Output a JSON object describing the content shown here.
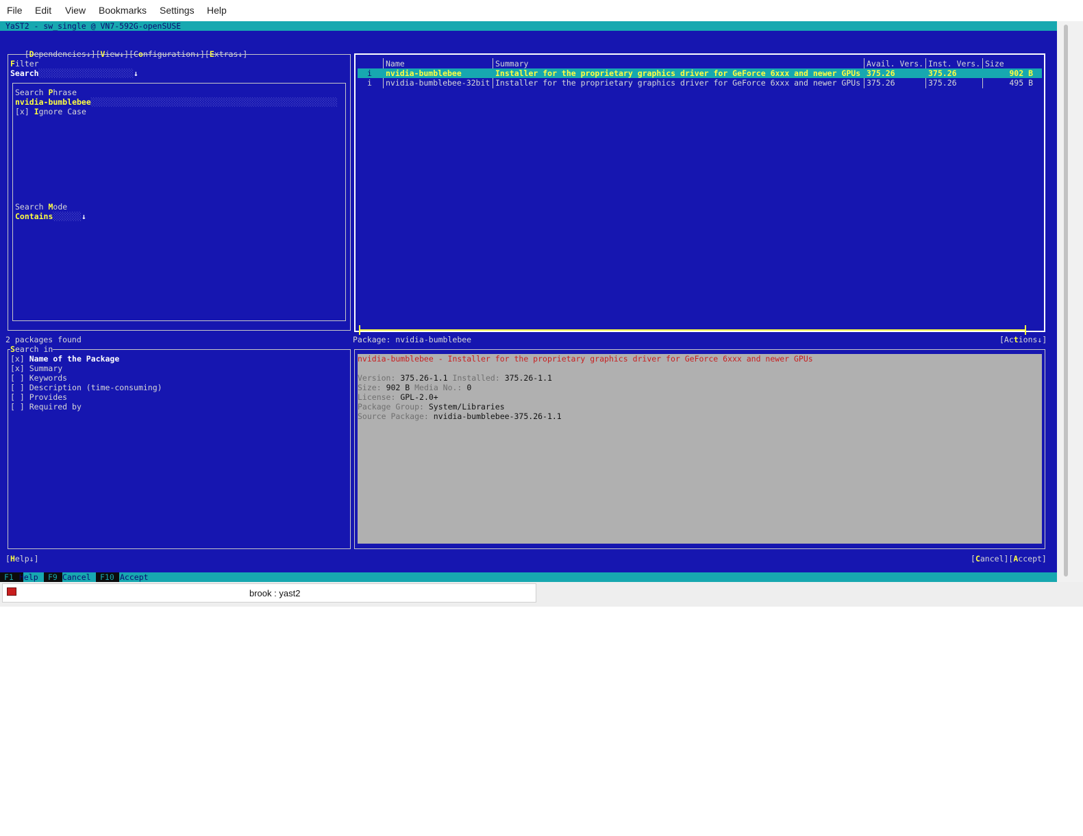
{
  "menubar": [
    "File",
    "Edit",
    "View",
    "Bookmarks",
    "Settings",
    "Help"
  ],
  "title": "YaST2 - sw_single @ VN7-592G-openSUSE",
  "top_menus": [
    {
      "open": "[",
      "hot": "D",
      "rest": "ependencies↓]"
    },
    {
      "open": "[",
      "hot": "V",
      "rest": "iew↓]"
    },
    {
      "open": "[C",
      "hot": "o",
      "rest": "nfiguration↓]"
    },
    {
      "open": "[",
      "hot": "E",
      "rest": "xtras↓]"
    }
  ],
  "filter": {
    "label_hot": "F",
    "label_rest": "ilter",
    "combo_value": "Search",
    "combo_arrow": "↓",
    "search_phrase_pre": "Search ",
    "search_phrase_hot": "P",
    "search_phrase_post": "hrase",
    "search_phrase_value": "nvidia-bumblebee",
    "ignore_case_box": "[x]",
    "ignore_case_hot": "I",
    "ignore_case_rest": "gnore Case",
    "search_mode_pre": "Search ",
    "search_mode_hot": "M",
    "search_mode_post": "ode",
    "search_mode_value": "Contains",
    "search_mode_arrow": "↓"
  },
  "status": "2 packages found",
  "search_in": {
    "hot": "S",
    "rest": "earch in",
    "options": [
      {
        "box": "[x]",
        "label": "Name of the Package",
        "checked": true
      },
      {
        "box": "[x]",
        "label": "Summary",
        "checked": true
      },
      {
        "box": "[ ]",
        "label": "Keywords",
        "checked": false
      },
      {
        "box": "[ ]",
        "label": "Description (time-consuming)",
        "checked": false
      },
      {
        "box": "[ ]",
        "label": "Provides",
        "checked": false
      },
      {
        "box": "[ ]",
        "label": "Required by",
        "checked": false
      }
    ]
  },
  "table": {
    "headers": [
      "Name",
      "Summary",
      "Avail. Vers.",
      "Inst. Vers.",
      "Size"
    ],
    "rows": [
      {
        "status": "i",
        "name": "nvidia-bumblebee",
        "summary": "Installer for the proprietary graphics driver for GeForce 6xxx and newer GPUs",
        "avail": "375.26",
        "inst": "375.26",
        "size": "902 B"
      },
      {
        "status": "i",
        "name": "nvidia-bumblebee-32bit",
        "summary": "Installer for the proprietary graphics driver for GeForce 6xxx and newer GPUs",
        "avail": "375.26",
        "inst": "375.26",
        "size": "495 B"
      }
    ]
  },
  "package_label": "Package: nvidia-bumblebee",
  "actions": {
    "open": "[Ac",
    "hot": "t",
    "rest": "ions↓]"
  },
  "details": {
    "headline": "nvidia-bumblebee - Installer for the proprietary graphics driver for GeForce 6xxx and newer GPUs",
    "version_label": "Version:",
    "version": "375.26-1.1",
    "installed_label": "Installed:",
    "installed": "375.26-1.1",
    "size_label": "Size:",
    "size": "902 B",
    "media_label": "Media No.:",
    "media": "0",
    "license_label": "License:",
    "license": "GPL-2.0+",
    "group_label": "Package Group:",
    "group": "System/Libraries",
    "source_label": "Source Package:",
    "source": "nvidia-bumblebee-375.26-1.1"
  },
  "help_button": {
    "open": "[",
    "hot": "H",
    "rest": "elp↓]"
  },
  "cancel_button": {
    "open": "[",
    "hot": "C",
    "rest": "ancel]"
  },
  "accept_button": {
    "open": "[",
    "hot": "A",
    "rest": "ccept]"
  },
  "fkeys": [
    {
      "key": "F1",
      "label": "Help"
    },
    {
      "key": "F9",
      "label": "Cancel"
    },
    {
      "key": "F10",
      "label": "Accept"
    }
  ],
  "taskbar_title": "brook : yast2",
  "colors": {
    "terminal_bg": "#1616b0",
    "cyan": "#17a8b0",
    "hotkey": "#ffff40",
    "detail_bg": "#b0b0b0",
    "headline_red": "#c81e1e"
  }
}
